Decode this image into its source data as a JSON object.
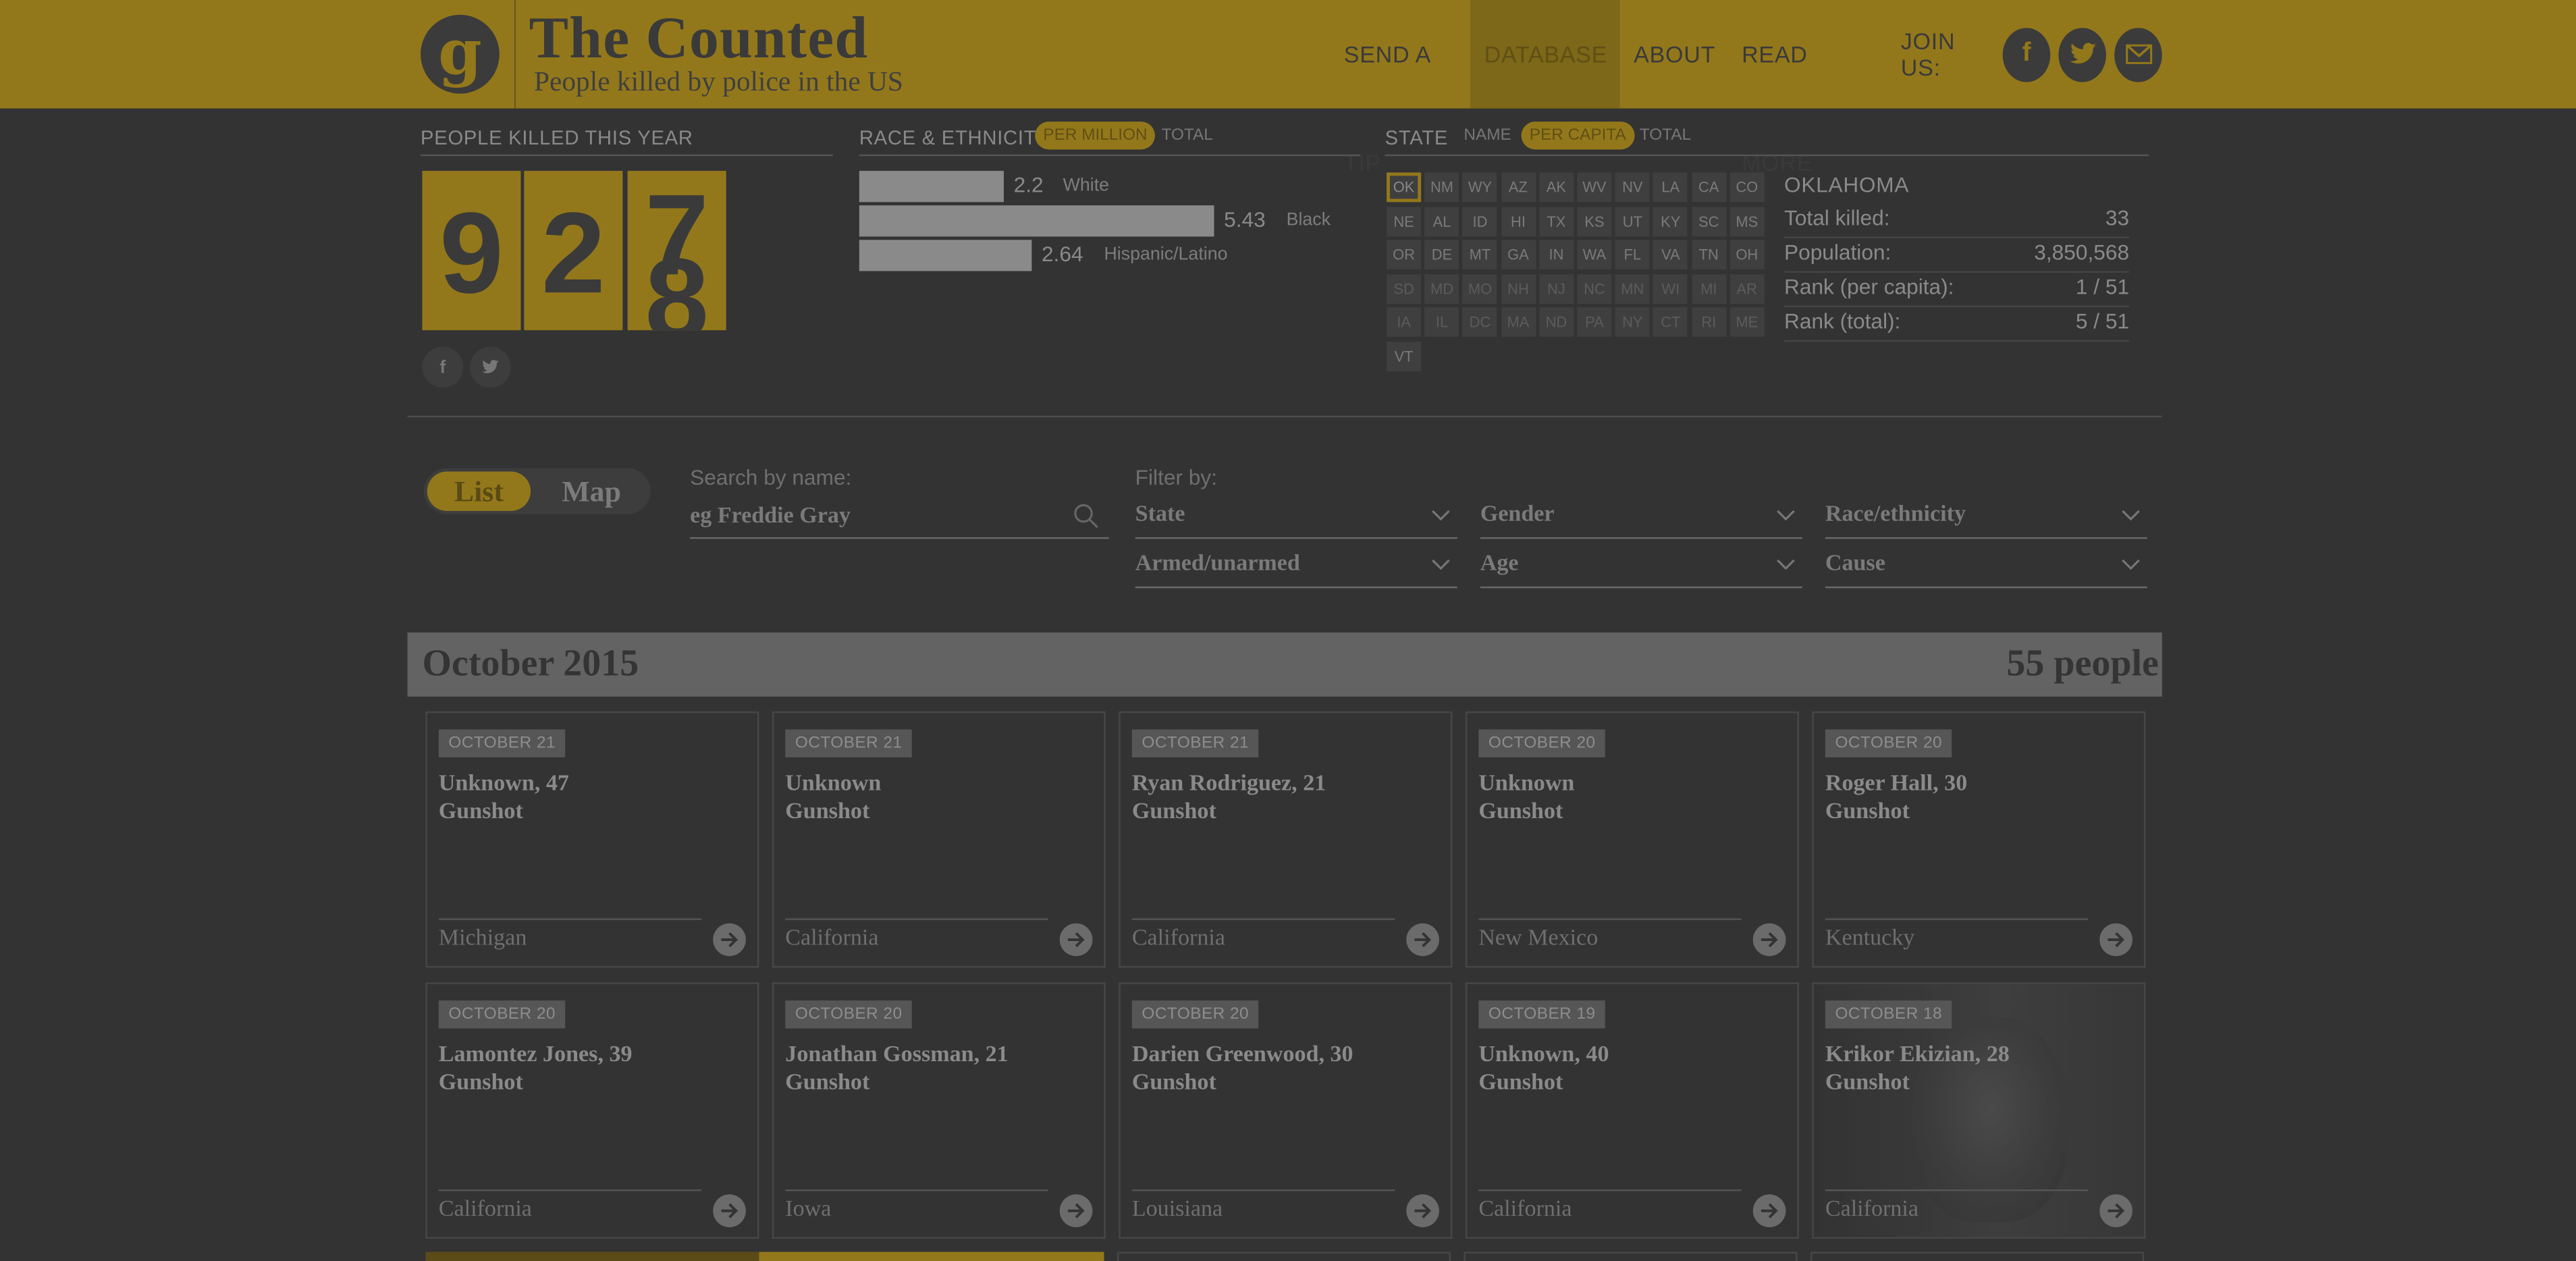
{
  "header": {
    "logo_letter": "g",
    "title": "The Counted",
    "subtitle": "People killed by police in the US",
    "nav": [
      "SEND A TIP",
      "DATABASE",
      "ABOUT",
      "READ MORE"
    ],
    "active_nav": "DATABASE",
    "join_us": "JOIN US:",
    "social_icons": [
      "facebook-icon",
      "twitter-icon",
      "email-icon"
    ]
  },
  "killed": {
    "label": "PEOPLE KILLED THIS YEAR",
    "digits": [
      "9",
      "2",
      "7"
    ],
    "next_digit": "8",
    "share_icons": [
      "facebook-icon",
      "twitter-icon"
    ]
  },
  "race": {
    "label": "RACE & ETHNICITY",
    "toggle": {
      "per_million": "PER MILLION",
      "total": "TOTAL",
      "selected": "PER MILLION"
    },
    "bars": [
      {
        "value": "2.2",
        "label": "White",
        "num": 2.2
      },
      {
        "value": "5.43",
        "label": "Black",
        "num": 5.43
      },
      {
        "value": "2.64",
        "label": "Hispanic/Latino",
        "num": 2.64
      }
    ]
  },
  "state": {
    "label": "STATE",
    "toggle": {
      "name": "NAME",
      "per_capita": "PER CAPITA",
      "total": "TOTAL",
      "selected": "PER CAPITA"
    },
    "grid": [
      [
        "OK",
        "NM",
        "WY",
        "AZ",
        "AK",
        "WV",
        "NV",
        "LA",
        "CA",
        "CO"
      ],
      [
        "NE",
        "AL",
        "ID",
        "HI",
        "TX",
        "KS",
        "UT",
        "KY",
        "SC",
        "MS"
      ],
      [
        "OR",
        "DE",
        "MT",
        "GA",
        "IN",
        "WA",
        "FL",
        "VA",
        "TN",
        "OH"
      ],
      [
        "SD",
        "MD",
        "MO",
        "NH",
        "NJ",
        "NC",
        "MN",
        "WI",
        "MI",
        "AR"
      ],
      [
        "IA",
        "IL",
        "DC",
        "MA",
        "ND",
        "PA",
        "NY",
        "CT",
        "RI",
        "ME"
      ],
      [
        "VT"
      ]
    ],
    "selected": "OK",
    "detail": {
      "name": "OKLAHOMA",
      "rows": [
        {
          "key": "Total killed:",
          "value": "33"
        },
        {
          "key": "Population:",
          "value": "3,850,568"
        },
        {
          "key": "Rank (per capita):",
          "value": "1 / 51"
        },
        {
          "key": "Rank (total):",
          "value": "5 / 51"
        }
      ]
    }
  },
  "controls": {
    "list": "List",
    "map": "Map",
    "search_label": "Search by name:",
    "search_placeholder": "eg Freddie Gray",
    "filter_label": "Filter by:",
    "filters": [
      "State",
      "Gender",
      "Race/ethnicity",
      "Armed/unarmed",
      "Age",
      "Cause"
    ]
  },
  "month": {
    "title": "October 2015",
    "count": "55 people"
  },
  "cards": [
    {
      "date": "OCTOBER 21",
      "name": "Unknown, 47",
      "cause": "Gunshot",
      "location": "Michigan"
    },
    {
      "date": "OCTOBER 21",
      "name": "Unknown",
      "cause": "Gunshot",
      "location": "California"
    },
    {
      "date": "OCTOBER 21",
      "name": "Ryan Rodriguez, 21",
      "cause": "Gunshot",
      "location": "California"
    },
    {
      "date": "OCTOBER 20",
      "name": "Unknown",
      "cause": "Gunshot",
      "location": "New Mexico"
    },
    {
      "date": "OCTOBER 20",
      "name": "Roger Hall, 30",
      "cause": "Gunshot",
      "location": "Kentucky"
    },
    {
      "date": "OCTOBER 20",
      "name": "Lamontez Jones, 39",
      "cause": "Gunshot",
      "location": "California"
    },
    {
      "date": "OCTOBER 20",
      "name": "Jonathan Gossman, 21",
      "cause": "Gunshot",
      "location": "Iowa"
    },
    {
      "date": "OCTOBER 20",
      "name": "Darien Greenwood, 30",
      "cause": "Gunshot",
      "location": "Louisiana"
    },
    {
      "date": "OCTOBER 19",
      "name": "Unknown, 40",
      "cause": "Gunshot",
      "location": "California"
    },
    {
      "date": "OCTOBER 18",
      "name": "Krikor Ekizian, 28",
      "cause": "Gunshot",
      "location": "California",
      "photo": true
    }
  ],
  "colors": {
    "accent": "#93781b",
    "background": "#333333",
    "band": "#636363"
  }
}
